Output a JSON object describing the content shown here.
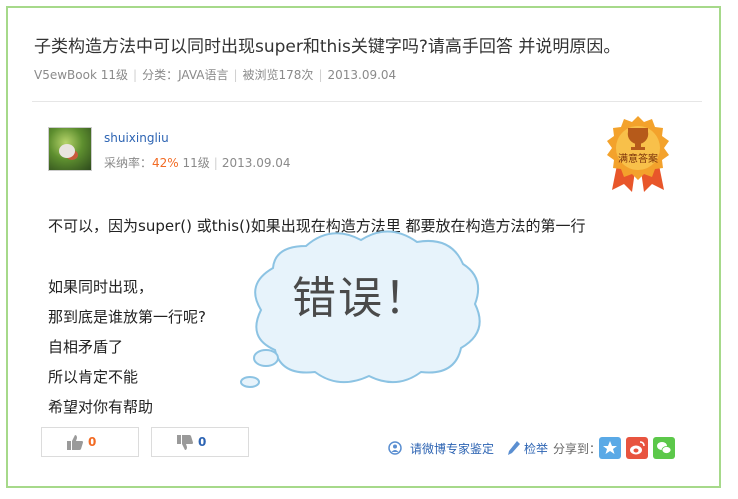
{
  "question": {
    "title": "子类构造方法中可以同时出现super和this关键字吗?请高手回答 并说明原因。",
    "author": "V5ewBook",
    "author_level": "11级",
    "category": "分类：JAVA语言",
    "views": "被浏览178次",
    "date": "2013.09.04"
  },
  "answer": {
    "user_name": "shuixingliu",
    "adopt_label": "采纳率：",
    "adopt_rate": "42%",
    "level": "11级",
    "date": "2013.09.04",
    "badge_text": "满意答案",
    "lines": [
      "不可以，因为super() 或this()如果出现在构造方法里 都要放在构造方法的第一行",
      "如果同时出现，",
      "那到底是谁放第一行呢?",
      "自相矛盾了",
      "所以肯定不能",
      "希望对你有帮助"
    ]
  },
  "overlay": {
    "text": "错误！"
  },
  "votes": {
    "up_count": "0",
    "down_count": "0"
  },
  "footer": {
    "expert_link": "请微博专家鉴定",
    "report_link": "检举",
    "share_label": "分享到："
  },
  "colors": {
    "border": "#a6d98a",
    "link": "#2d64b3",
    "accent": "#f26b24"
  },
  "icons": [
    "avatar",
    "satisfied-answer-badge",
    "thumb-up-icon",
    "thumb-down-icon",
    "expert-icon",
    "pen-icon",
    "qzone-icon",
    "weibo-icon",
    "wechat-icon",
    "speech-cloud"
  ]
}
